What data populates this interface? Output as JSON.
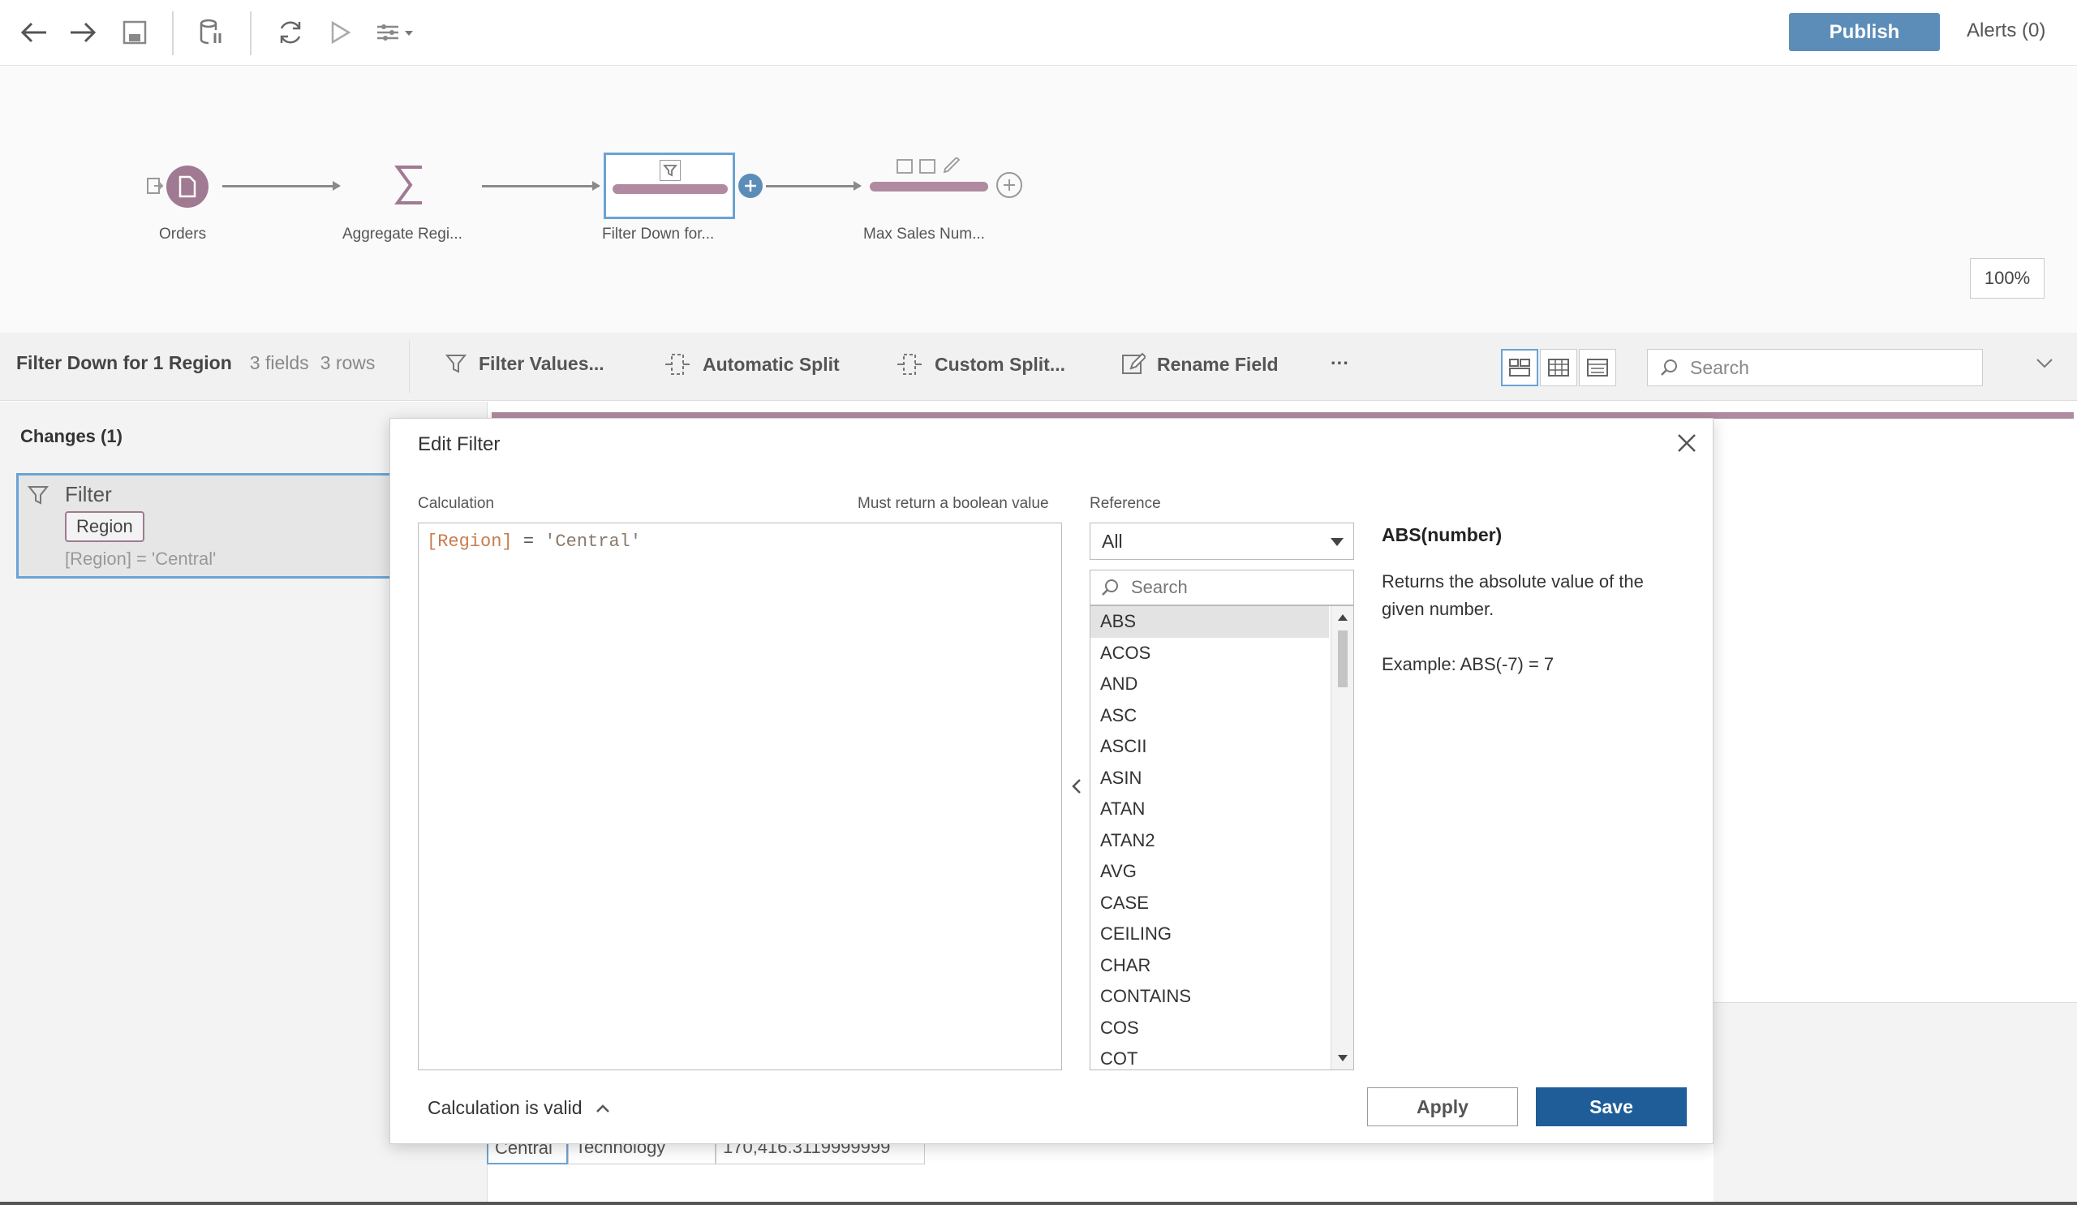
{
  "toolbar": {
    "icons": [
      "back-icon",
      "forward-icon",
      "save-icon",
      "data-interpreter-icon",
      "refresh-icon",
      "run-icon",
      "flow-options-icon"
    ],
    "publish_label": "Publish",
    "alerts_label": "Alerts (0)"
  },
  "flow": {
    "nodes": [
      {
        "label": "Orders",
        "type": "input"
      },
      {
        "label": "Aggregate Regi...",
        "type": "aggregate"
      },
      {
        "label": "Filter Down for...",
        "type": "clean"
      },
      {
        "label": "Max Sales Num...",
        "type": "clean"
      }
    ],
    "zoom": "100%"
  },
  "step": {
    "title": "Filter Down for 1 Region",
    "fields": "3 fields",
    "rows": "3 rows",
    "actions": [
      "Filter Values...",
      "Automatic Split",
      "Custom Split...",
      "Rename Field"
    ],
    "more": "···",
    "search_placeholder": "Search"
  },
  "changes": {
    "title": "Changes (1)",
    "card": {
      "type": "Filter",
      "field": "Region",
      "expression": "[Region] = 'Central'"
    }
  },
  "dialog": {
    "title": "Edit Filter",
    "calc_label": "Calculation",
    "calc_hint": "Must return a boolean value",
    "calc_field": "[Region]",
    "calc_op": " = ",
    "calc_string": "'Central'",
    "reference_label": "Reference",
    "reference_selected": "All",
    "search_placeholder": "Search",
    "functions": [
      "ABS",
      "ACOS",
      "AND",
      "ASC",
      "ASCII",
      "ASIN",
      "ATAN",
      "ATAN2",
      "AVG",
      "CASE",
      "CEILING",
      "CHAR",
      "CONTAINS",
      "COS",
      "COT"
    ],
    "fn_signature": "ABS(number)",
    "fn_description": "Returns the absolute value of the given number.",
    "fn_example": "Example: ABS(-7) = 7",
    "status": "Calculation is valid",
    "apply_label": "Apply",
    "save_label": "Save"
  },
  "table_peek": [
    "Central",
    "Technology",
    "170,416.3119999999"
  ],
  "colors": {
    "accent": "#5b8db8",
    "save": "#1f5d99",
    "node": "#b08aa0",
    "selection": "#6aa3d5"
  }
}
